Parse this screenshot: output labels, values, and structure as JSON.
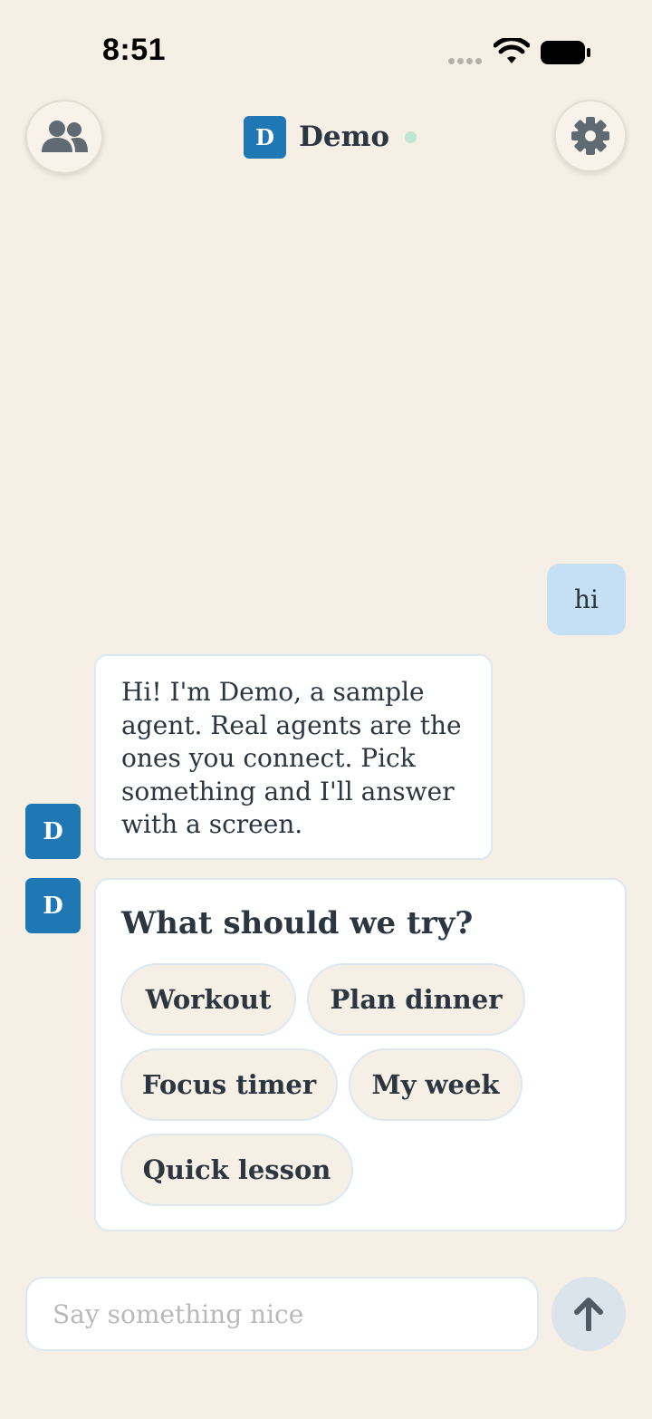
{
  "status_bar": {
    "time": "8:51"
  },
  "header": {
    "agent_initial": "D",
    "agent_name": "Demo",
    "online_color": "#bfe6d3",
    "accent_color": "#1f78b4"
  },
  "messages": {
    "user": {
      "text": "hi"
    },
    "agent_avatar_initial": "D",
    "agent_text": "Hi! I'm Demo, a sample agent. Real agents are the ones you connect. Pick something and I'll answer with a screen."
  },
  "choice_card": {
    "title": "What should we try?",
    "options": [
      "Workout",
      "Plan dinner",
      "Focus timer",
      "My week",
      "Quick lesson"
    ]
  },
  "composer": {
    "placeholder": "Say something nice",
    "value": ""
  },
  "icons": {
    "people": "people-icon",
    "settings": "gear-icon",
    "send": "arrow-up-icon",
    "wifi": "wifi-icon",
    "battery": "battery-icon"
  }
}
